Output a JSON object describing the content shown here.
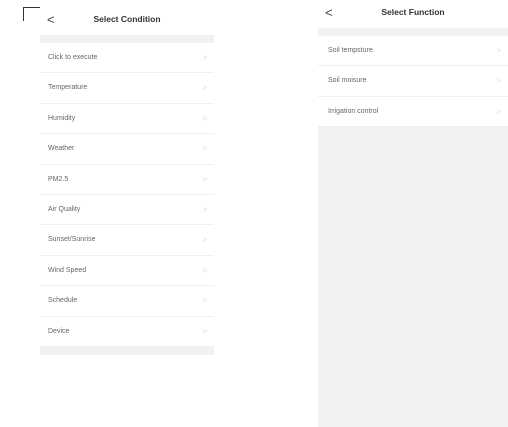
{
  "condition_screen": {
    "back_glyph": "<",
    "title": "Select Condition",
    "items": [
      {
        "label": "Click to execute"
      },
      {
        "label": "Temperature"
      },
      {
        "label": "Humidity"
      },
      {
        "label": "Weather"
      },
      {
        "label": "PM2.5"
      },
      {
        "label": "Air Quality"
      },
      {
        "label": "Sunset/Sunrise"
      },
      {
        "label": "Wind Speed"
      },
      {
        "label": "Schedule"
      },
      {
        "label": "Device"
      }
    ]
  },
  "function_screen": {
    "back_glyph": "<",
    "title": "Select Function",
    "items": [
      {
        "label": "Soil tempsture"
      },
      {
        "label": "Soil moisure"
      },
      {
        "label": "Irrigation control"
      }
    ]
  },
  "chevron_glyph": ">"
}
